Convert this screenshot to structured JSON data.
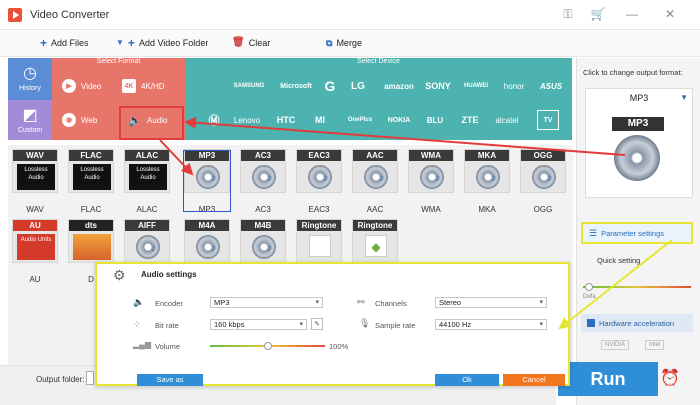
{
  "window": {
    "title": "Video Converter",
    "controls": [
      "key-icon",
      "cart-icon",
      "minimize-icon",
      "close-icon"
    ]
  },
  "toolbar": {
    "add_files": "Add Files",
    "add_video_folder": "Add Video Folder",
    "clear": "Clear",
    "merge": "Merge"
  },
  "nav": {
    "history": "History",
    "custom": "Custom"
  },
  "format_panel": {
    "header": "Select Format",
    "video": "Video",
    "hd": "4K/HD",
    "web": "Web",
    "audio": "Audio"
  },
  "device_panel": {
    "header": "Select Device",
    "row1": [
      "SAMSUNG",
      "Microsoft",
      "G",
      "LG",
      "amazon",
      "SONY",
      "HUAWEI",
      "honor",
      "ASUS"
    ],
    "row2": [
      "Lenovo",
      "HTC",
      "MI",
      "OnePlus",
      "NOKIA",
      "BLU",
      "ZTE",
      "alcatel",
      "TV"
    ]
  },
  "formats_row1": [
    {
      "name": "WAV",
      "label": "WAV",
      "kind": "lossless"
    },
    {
      "name": "FLAC",
      "label": "FLAC",
      "kind": "lossless"
    },
    {
      "name": "ALAC",
      "label": "ALAC",
      "kind": "lossless"
    },
    {
      "name": "MP3",
      "label": "MP3",
      "kind": "disc"
    },
    {
      "name": "AC3",
      "label": "AC3",
      "kind": "disc"
    },
    {
      "name": "EAC3",
      "label": "EAC3",
      "kind": "disc"
    },
    {
      "name": "AAC",
      "label": "AAC",
      "kind": "disc"
    },
    {
      "name": "WMA",
      "label": "WMA",
      "kind": "disc"
    },
    {
      "name": "MKA",
      "label": "MKA",
      "kind": "disc"
    },
    {
      "name": "OGG",
      "label": "OGG",
      "kind": "disc"
    }
  ],
  "formats_row2": [
    {
      "name": "AU",
      "label": "AU",
      "kind": "au"
    },
    {
      "name": "dts",
      "label": "D",
      "kind": "dts"
    },
    {
      "name": "AIFF",
      "label": "",
      "kind": "disc"
    },
    {
      "name": "M4A",
      "label": "",
      "kind": "disc"
    },
    {
      "name": "M4B",
      "label": "",
      "kind": "disc"
    },
    {
      "name": "Ringtone",
      "label": "",
      "kind": "apple"
    },
    {
      "name": "Ringtone",
      "label": "",
      "kind": "android"
    }
  ],
  "tile_subtext": {
    "lossless": "Lossless Audio",
    "au": "Audio Units"
  },
  "right_panel": {
    "hint": "Click to change output format:",
    "selected_format": "MP3",
    "parameter_settings": "Parameter settings",
    "quick_setting": "Quick setting",
    "default_label": "Defa",
    "hardware_acceleration": "Hardware acceleration",
    "nvidia": "NVIDIA",
    "intel": "Intel"
  },
  "dialog": {
    "title": "Audio settings",
    "encoder_label": "Encoder",
    "encoder_value": "MP3",
    "bitrate_label": "Bit rate",
    "bitrate_value": "160 kbps",
    "volume_label": "Volume",
    "volume_value": "100%",
    "volume_level": 0.5,
    "channels_label": "Channels",
    "channels_value": "Stereo",
    "samplerate_label": "Sample rate",
    "samplerate_value": "44100 Hz",
    "save_as": "Save as",
    "ok": "Ok",
    "cancel": "Cancel"
  },
  "bottom": {
    "output_folder_label": "Output folder:",
    "run": "Run"
  },
  "colors": {
    "format_panel": "#e8756a",
    "device_panel": "#4db3b0",
    "run_button": "#2e8fd8",
    "annotation_red": "#e23b3b",
    "annotation_yellow": "#e6e632"
  }
}
